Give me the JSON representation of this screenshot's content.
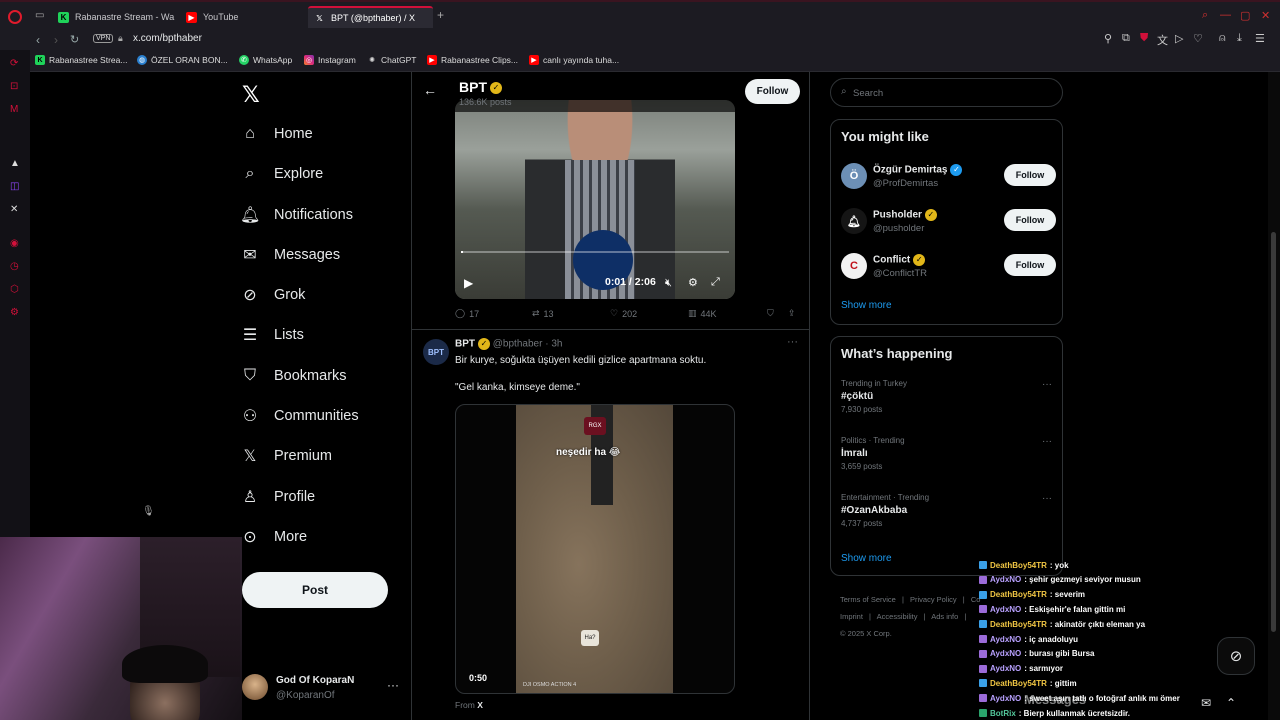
{
  "browser": {
    "tabs": [
      {
        "label": "Rabanastre Stream - Wa",
        "icon": "rabanastre-green-icon"
      },
      {
        "label": "YouTube",
        "icon": "youtube-icon"
      },
      {
        "label": "BPT (@bpthaber) / X",
        "icon": "x-icon"
      }
    ],
    "vpn_label": "VPN",
    "url": "x.com/bpthaber",
    "bookmarks": [
      {
        "label": "Rabanastree Strea...",
        "icon": "rabanastre-icon"
      },
      {
        "label": "ÖZEL ORAN BON...",
        "icon": "globe-icon"
      },
      {
        "label": "WhatsApp",
        "icon": "whatsapp-icon"
      },
      {
        "label": "Instagram",
        "icon": "instagram-icon"
      },
      {
        "label": "ChatGPT",
        "icon": "chatgpt-icon"
      },
      {
        "label": "Rabanastree Clips...",
        "icon": "youtube-icon"
      },
      {
        "label": "canlı yayında tuha...",
        "icon": "youtube-icon"
      }
    ],
    "accent": "#d0103a"
  },
  "nav": {
    "items": [
      {
        "label": "Home",
        "icon": "home-icon"
      },
      {
        "label": "Explore",
        "icon": "search-icon"
      },
      {
        "label": "Notifications",
        "icon": "bell-icon"
      },
      {
        "label": "Messages",
        "icon": "envelope-icon"
      },
      {
        "label": "Grok",
        "icon": "grok-icon"
      },
      {
        "label": "Lists",
        "icon": "list-icon"
      },
      {
        "label": "Bookmarks",
        "icon": "bookmark-icon"
      },
      {
        "label": "Communities",
        "icon": "people-icon"
      },
      {
        "label": "Premium",
        "icon": "x-icon"
      },
      {
        "label": "Profile",
        "icon": "person-icon"
      },
      {
        "label": "More",
        "icon": "more-circle-icon"
      }
    ],
    "post_label": "Post",
    "account": {
      "name": "God Of KoparaN",
      "handle": "@KoparanOf"
    }
  },
  "profile_header": {
    "name": "BPT",
    "posts_count": "136.6K posts",
    "follow_label": "Follow"
  },
  "tweet1": {
    "video_time": "0:01 / 2:06",
    "progress": 0.008,
    "replies": "17",
    "reposts": "13",
    "likes": "202",
    "views": "44K"
  },
  "tweet2": {
    "name": "BPT",
    "handle": "@bpthaber",
    "time": "3h",
    "text": "Bir kurye, soğukta üşüyen kedili gizlice apartmana soktu.",
    "quote": "\"Gel kanka, kimseye deme.\"",
    "video_caption": "neşedir ha 😂",
    "video_tag": "RGX",
    "video_sticker": "Ha?",
    "video_watermark": "DJI OSMO ACTION 4",
    "video_duration": "0:50",
    "from_prefix": "From",
    "from_source": "X"
  },
  "sidebar": {
    "search_placeholder": "Search",
    "might_like_title": "You might like",
    "suggestions": [
      {
        "name": "Özgür Demirtaş",
        "handle": "@ProfDemirtas",
        "badge": "blue",
        "follow": "Follow"
      },
      {
        "name": "Pusholder",
        "handle": "@pusholder",
        "badge": "gold",
        "follow": "Follow"
      },
      {
        "name": "Conflict",
        "handle": "@ConflictTR",
        "badge": "gold",
        "follow": "Follow"
      }
    ],
    "show_more_1": "Show more",
    "happening_title": "What’s happening",
    "trends": [
      {
        "context": "Trending in Turkey",
        "topic": "#çöktü",
        "posts": "7,930 posts"
      },
      {
        "context": "Politics · Trending",
        "topic": "İmralı",
        "posts": "3,659 posts"
      },
      {
        "context": "Entertainment · Trending",
        "topic": "#OzanAkbaba",
        "posts": "4,737 posts"
      }
    ],
    "show_more_2": "Show more",
    "footer": [
      "Terms of Service",
      "|",
      "Privacy Policy",
      "|",
      "Co",
      "Imprint",
      "|",
      "Accessibility",
      "|",
      "Ads info",
      "|",
      "© 2025 X Corp."
    ]
  },
  "chat": [
    {
      "user": "DeathBoy54TR",
      "text": ": yok",
      "type": "d"
    },
    {
      "user": "AydxNO",
      "text": ": şehir gezmeyi seviyor musun",
      "type": "a"
    },
    {
      "user": "DeathBoy54TR",
      "text": ": severim",
      "type": "d"
    },
    {
      "user": "AydxNO",
      "text": ": Eskişehir'e falan gittin mi",
      "type": "a"
    },
    {
      "user": "DeathBoy54TR",
      "text": ": akinatör çıktı eleman ya",
      "type": "d"
    },
    {
      "user": "AydxNO",
      "text": ": iç anadoluyu",
      "type": "a"
    },
    {
      "user": "AydxNO",
      "text": ": burası gibi Bursa",
      "type": "a"
    },
    {
      "user": "AydxNO",
      "text": ": sarmıyor",
      "type": "a"
    },
    {
      "user": "DeathBoy54TR",
      "text": ": gittim",
      "type": "d"
    },
    {
      "user": "AydxNO",
      "text": ": sweet aşırı tatlı o fotoğraf anlık mı ömer",
      "type": "a"
    },
    {
      "user": "BotRix",
      "text": ": Bierp kullanmak ücretsizdir.",
      "type": "b"
    }
  ],
  "messages_drawer_label": "Messages"
}
